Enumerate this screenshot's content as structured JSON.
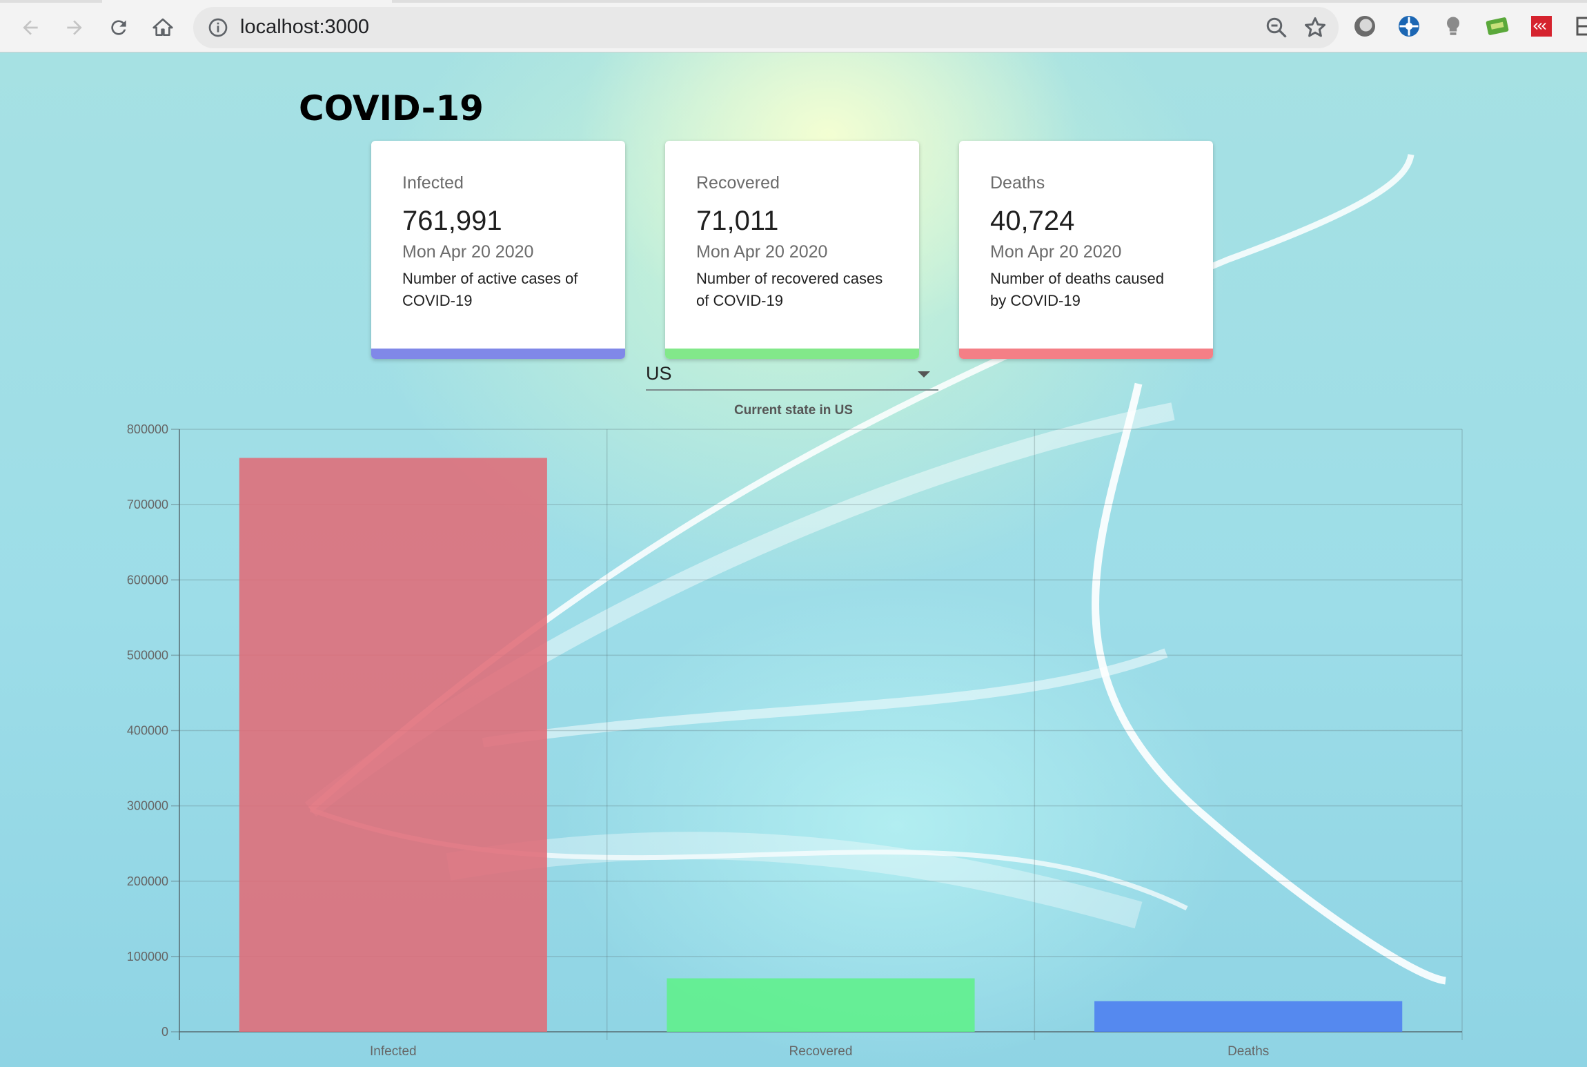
{
  "browser": {
    "url": "localhost:3000"
  },
  "page": {
    "title": "COVID-19"
  },
  "cards": [
    {
      "label": "Infected",
      "value": "761,991",
      "date": "Mon Apr 20 2020",
      "description": "Number of active cases of COVID-19",
      "color": "#8088e8"
    },
    {
      "label": "Recovered",
      "value": "71,011",
      "date": "Mon Apr 20 2020",
      "description": "Number of recovered cases of COVID-19",
      "color": "#82e88a"
    },
    {
      "label": "Deaths",
      "value": "40,724",
      "date": "Mon Apr 20 2020",
      "description": "Number of deaths caused by COVID-19",
      "color": "#f47f86"
    }
  ],
  "country_select": {
    "selected": "US"
  },
  "chart_data": {
    "type": "bar",
    "title": "Current state in US",
    "categories": [
      "Infected",
      "Recovered",
      "Deaths"
    ],
    "values": [
      761991,
      71011,
      40724
    ],
    "colors": [
      "#e06c78",
      "#5ff08a",
      "#4c7ef0"
    ],
    "ylim": [
      0,
      800000
    ],
    "yticks": [
      0,
      100000,
      200000,
      300000,
      400000,
      500000,
      600000,
      700000,
      800000
    ],
    "grid": true,
    "legend": "none"
  }
}
